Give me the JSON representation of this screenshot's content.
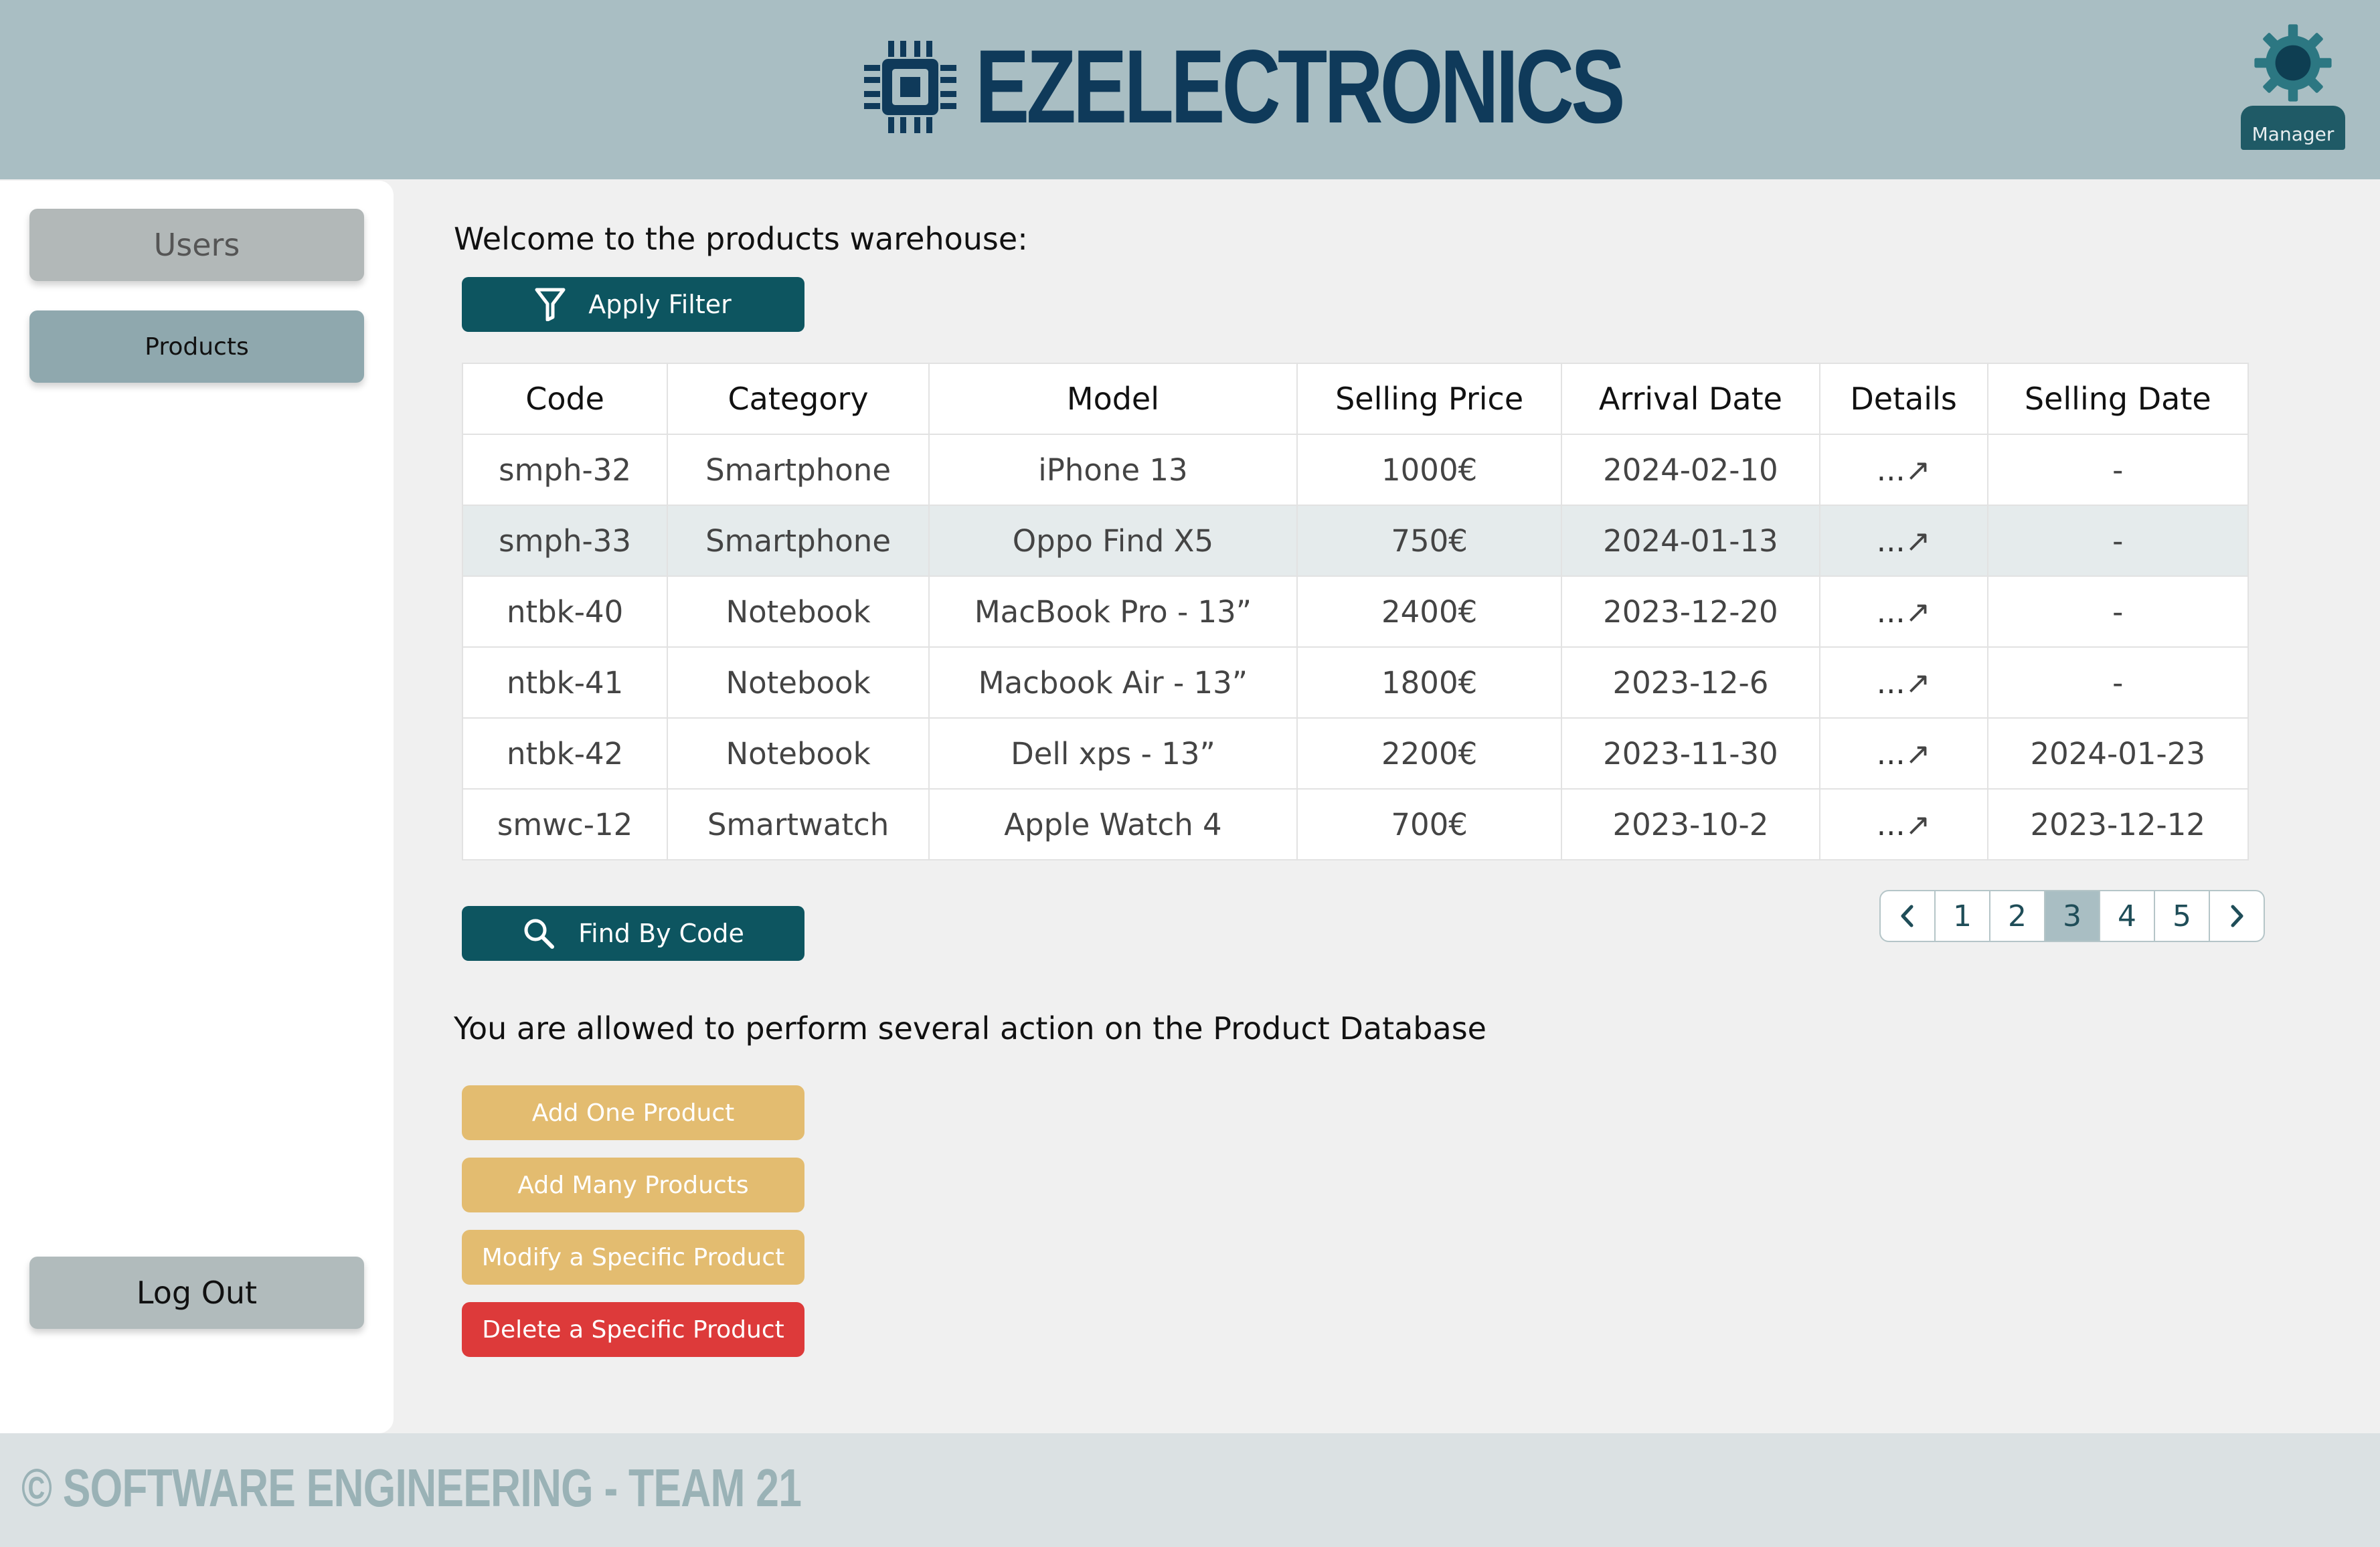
{
  "header": {
    "brand": "EZELECTRONICS",
    "role_label": "Manager"
  },
  "sidebar": {
    "items": [
      {
        "label": "Users"
      },
      {
        "label": "Products"
      }
    ],
    "logout_label": "Log Out"
  },
  "main": {
    "welcome": "Welcome to the products warehouse:",
    "filter_label": "Apply Filter",
    "find_label": "Find By Code",
    "actions_intro": "You are allowed to perform several action on the Product Database",
    "actions": [
      {
        "label": "Add One Product"
      },
      {
        "label": "Add Many Products"
      },
      {
        "label": "Modify a Specific Product"
      },
      {
        "label": "Delete a Specific Product"
      }
    ],
    "table": {
      "columns": [
        "Code",
        "Category",
        "Model",
        "Selling Price",
        "Arrival Date",
        "Details",
        "Selling Date"
      ],
      "rows": [
        {
          "code": "smph-32",
          "category": "Smartphone",
          "model": "iPhone 13",
          "price": "1000€",
          "arrival": "2024-02-10",
          "details": "...",
          "selling": "-"
        },
        {
          "code": "smph-33",
          "category": "Smartphone",
          "model": "Oppo Find X5",
          "price": "750€",
          "arrival": "2024-01-13",
          "details": "...",
          "selling": "-"
        },
        {
          "code": "ntbk-40",
          "category": "Notebook",
          "model": "MacBook Pro - 13”",
          "price": "2400€",
          "arrival": "2023-12-20",
          "details": "...",
          "selling": "-"
        },
        {
          "code": "ntbk-41",
          "category": "Notebook",
          "model": "Macbook Air - 13”",
          "price": "1800€",
          "arrival": "2023-12-6",
          "details": "...",
          "selling": "-"
        },
        {
          "code": "ntbk-42",
          "category": "Notebook",
          "model": "Dell xps - 13”",
          "price": "2200€",
          "arrival": "2023-11-30",
          "details": "...",
          "selling": "2024-01-23"
        },
        {
          "code": "smwc-12",
          "category": "Smartwatch",
          "model": "Apple Watch 4",
          "price": "700€",
          "arrival": "2023-10-2",
          "details": "...",
          "selling": "2023-12-12"
        }
      ]
    },
    "pagination": {
      "pages": [
        "1",
        "2",
        "3",
        "4",
        "5"
      ],
      "current": "3"
    }
  },
  "footer": {
    "text": "© SOFTWARE ENGINEERING - TEAM 21"
  },
  "colors": {
    "header_bg": "#a9bec3",
    "primary": "#0d5560",
    "warning": "#e3bc70",
    "danger": "#dd3a3a",
    "brand": "#0f3a5a"
  }
}
